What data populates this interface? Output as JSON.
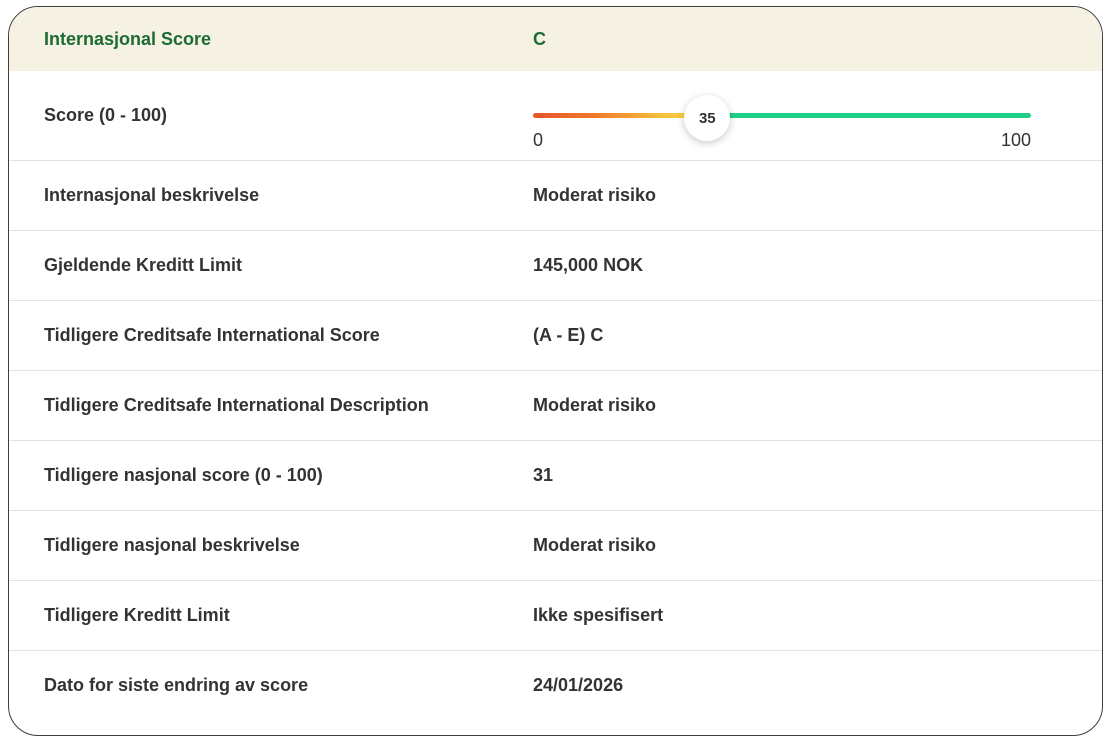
{
  "header": {
    "label": "Internasjonal Score",
    "value": "C"
  },
  "score": {
    "label": "Score (0 - 100)",
    "value": "35",
    "min": "0",
    "max": "100",
    "fraction": 0.35
  },
  "rows": [
    {
      "label": "Internasjonal beskrivelse",
      "value": "Moderat risiko"
    },
    {
      "label": "Gjeldende Kreditt Limit",
      "value": "145,000 NOK"
    },
    {
      "label": "Tidligere Creditsafe International Score",
      "value": "(A - E) C"
    },
    {
      "label": "Tidligere Creditsafe International Description",
      "value": "Moderat risiko"
    },
    {
      "label": "Tidligere nasjonal score (0 - 100)",
      "value": "31"
    },
    {
      "label": "Tidligere nasjonal beskrivelse",
      "value": "Moderat risiko"
    },
    {
      "label": "Tidligere Kreditt Limit",
      "value": "Ikke spesifisert"
    },
    {
      "label": "Dato for siste endring av score",
      "value": "24/01/2026"
    }
  ],
  "colors": {
    "header_bg": "#f5f1e3",
    "header_text": "#1d6b32",
    "bar_low": "#e8542b",
    "bar_mid": "#f6c23a",
    "bar_high": "#1fcf86"
  }
}
